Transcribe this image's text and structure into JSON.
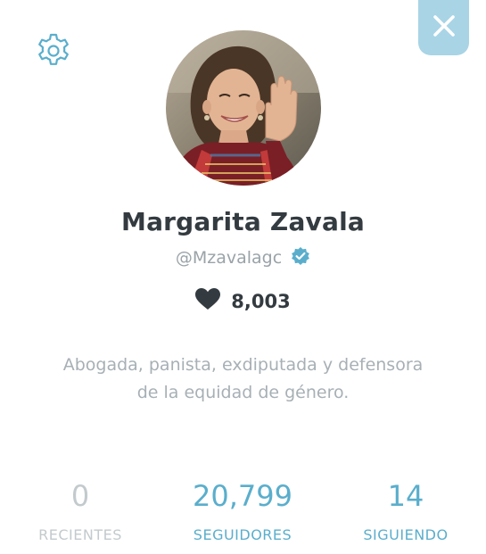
{
  "profile": {
    "name": "Margarita Zavala",
    "handle": "@Mzavalagc",
    "verified": true,
    "likes": "8,003",
    "bio": "Abogada, panista, exdiputada y defensora de la equidad de género."
  },
  "stats": [
    {
      "value": "0",
      "label": "RECIENTES",
      "active": false
    },
    {
      "value": "20,799",
      "label": "SEGUIDORES",
      "active": true
    },
    {
      "value": "14",
      "label": "SIGUIENDO",
      "active": true
    }
  ],
  "icons": {
    "settings": "gear-icon",
    "close": "close-icon",
    "verified": "verified-badge-icon",
    "likes": "heart-icon"
  },
  "colors": {
    "accent": "#5aaecc",
    "close_bg": "#a8d4e6",
    "verified": "#5aaecc",
    "name": "#333b40",
    "muted": "#a7b0b5",
    "inactive": "#c3cacd"
  }
}
